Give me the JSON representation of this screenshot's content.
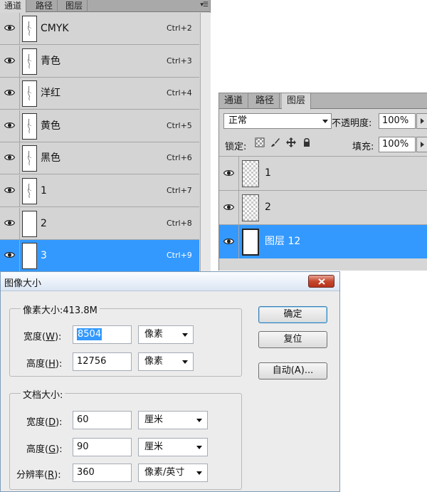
{
  "channels_panel": {
    "tabs": [
      "通道",
      "路径",
      "图层"
    ],
    "active_tab": 0,
    "menu_icon": "panel-menu-icon",
    "rows": [
      {
        "name": "CMYK",
        "shortcut": "Ctrl+2",
        "selected": false
      },
      {
        "name": "青色",
        "shortcut": "Ctrl+3",
        "selected": false
      },
      {
        "name": "洋红",
        "shortcut": "Ctrl+4",
        "selected": false
      },
      {
        "name": "黄色",
        "shortcut": "Ctrl+5",
        "selected": false
      },
      {
        "name": "黑色",
        "shortcut": "Ctrl+6",
        "selected": false
      },
      {
        "name": "1",
        "shortcut": "Ctrl+7",
        "selected": false
      },
      {
        "name": "2",
        "shortcut": "Ctrl+8",
        "selected": false
      },
      {
        "name": "3",
        "shortcut": "Ctrl+9",
        "selected": true
      }
    ]
  },
  "layers_panel": {
    "tabs": [
      "通道",
      "路径",
      "图层"
    ],
    "active_tab": 2,
    "blend_mode": "正常",
    "opacity_label": "不透明度:",
    "opacity_value": "100%",
    "lock_label": "锁定:",
    "fill_label": "填充:",
    "fill_value": "100%",
    "layers": [
      {
        "name": "1",
        "selected": false
      },
      {
        "name": "2",
        "selected": false
      },
      {
        "name": "图层 12",
        "selected": true
      }
    ]
  },
  "image_size_dialog": {
    "title": "图像大小",
    "pixel_dimensions": {
      "legend": "像素大小:413.8M",
      "width_label": "宽度",
      "width_key": "W",
      "width_value": "8504",
      "width_unit": "像素",
      "height_label": "高度",
      "height_key": "H",
      "height_value": "12756",
      "height_unit": "像素"
    },
    "document_size": {
      "legend": "文档大小:",
      "width_label": "宽度",
      "width_key": "D",
      "width_value": "60",
      "width_unit": "厘米",
      "height_label": "高度",
      "height_key": "G",
      "height_value": "90",
      "height_unit": "厘米",
      "resolution_label": "分辨率",
      "resolution_key": "R",
      "resolution_value": "360",
      "resolution_unit": "像素/英寸"
    },
    "buttons": {
      "ok": "确定",
      "reset": "复位",
      "auto": "自动(A)..."
    }
  },
  "colors": {
    "selection_blue": "#3399ff",
    "panel_gray": "#d4d4d4"
  }
}
